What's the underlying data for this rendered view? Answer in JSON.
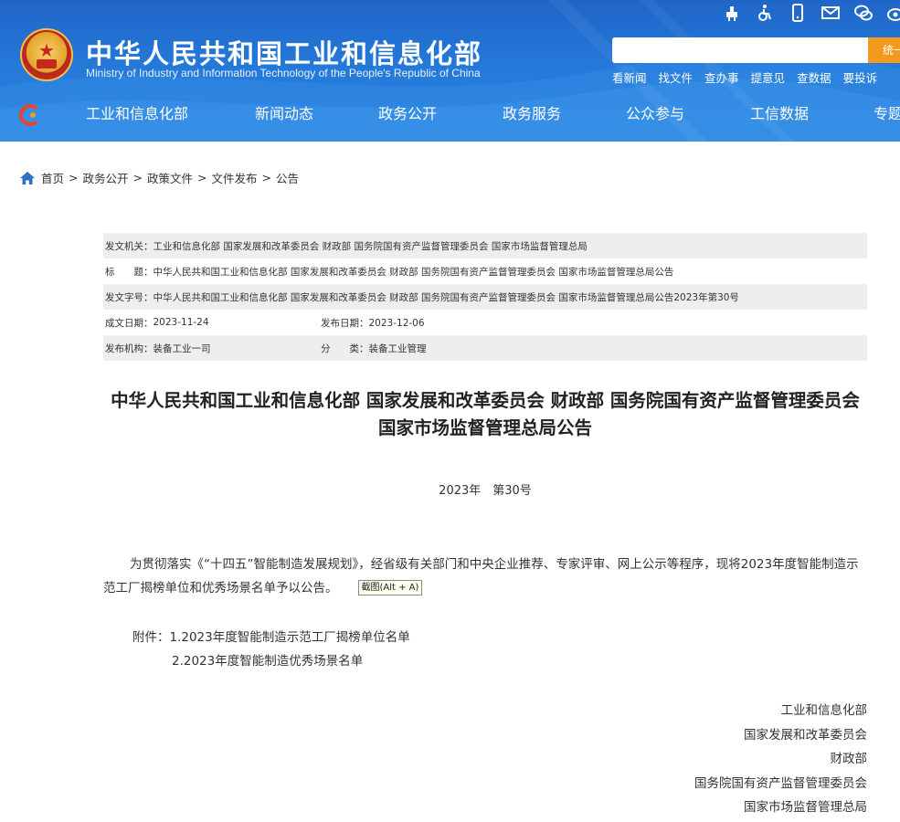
{
  "header": {
    "title": "中华人民共和国工业和信息化部",
    "subtitle": "Ministry of Industry and Information Technology of the People's Republic of China",
    "search": {
      "placeholder": "",
      "button_label": "统一"
    },
    "quick_links": [
      "看新闻",
      "找文件",
      "查办事",
      "提意见",
      "查数据",
      "要投诉"
    ],
    "utility_icons": [
      "accessibility-icon",
      "wheelchair-icon",
      "mobile-icon",
      "mail-icon",
      "wechat-icon",
      "weibo-icon"
    ],
    "colors": {
      "primary": "#2478d8",
      "search_button": "#f29a1d"
    }
  },
  "nav": {
    "items": [
      "工业和信息化部",
      "新闻动态",
      "政务公开",
      "政务服务",
      "公众参与",
      "工信数据",
      "专题"
    ]
  },
  "breadcrumb": [
    "首页",
    "政务公开",
    "政策文件",
    "文件发布",
    "公告"
  ],
  "meta": {
    "issuer_label": "发文机关：",
    "issuer": "工业和信息化部 国家发展和改革委员会 财政部 国务院国有资产监督管理委员会 国家市场监督管理总局",
    "title_label": "标　　题：",
    "title": "中华人民共和国工业和信息化部 国家发展和改革委员会 财政部 国务院国有资产监督管理委员会 国家市场监督管理总局公告",
    "doc_no_label": "发文字号：",
    "doc_no": "中华人民共和国工业和信息化部 国家发展和改革委员会 财政部 国务院国有资产监督管理委员会 国家市场监督管理总局公告2023年第30号",
    "date_label": "成文日期：",
    "date": "2023-11-24",
    "publish_label": "发布日期：",
    "publish_date": "2023-12-06",
    "org_label": "发布机构：",
    "org": "装备工业一司",
    "category_label": "分　　类：",
    "category": "装备工业管理"
  },
  "document": {
    "title": "中华人民共和国工业和信息化部 国家发展和改革委员会 财政部 国务院国有资产监督管理委员会 国家市场监督管理总局公告",
    "number": "2023年　第30号",
    "body": "为贯彻落实《“十四五”智能制造发展规划》，经省级有关部门和中央企业推荐、专家评审、网上公示等程序，现将2023年度智能制造示范工厂揭榜单位和优秀场景名单予以公告。",
    "screenshot_hint": "截图(Alt + A)",
    "attachment_1": "附件：1.2023年度智能制造示范工厂揭榜单位名单",
    "attachment_2": "2.2023年度智能制造优秀场景名单",
    "signers": [
      "工业和信息化部",
      "国家发展和改革委员会",
      "财政部",
      "国务院国有资产监督管理委员会",
      "国家市场监督管理总局"
    ]
  }
}
